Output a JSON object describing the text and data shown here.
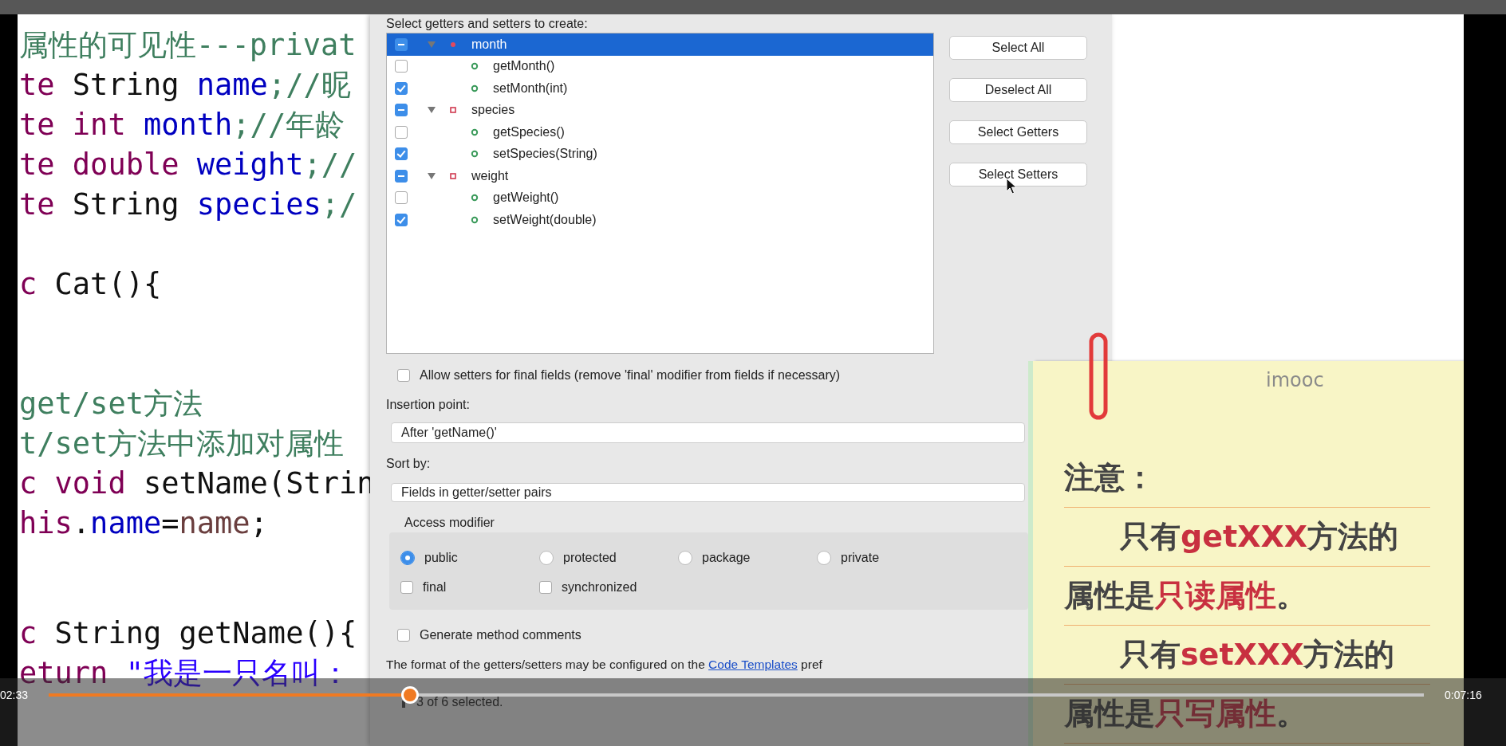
{
  "code_blocks": [
    {
      "kind": "declarations",
      "lines": [
        [
          {
            "text": "属性的可见性---privat",
            "kind": "comment"
          }
        ],
        [
          {
            "text": "te",
            "kind": "keyword"
          },
          {
            "text": " String ",
            "kind": "plain"
          },
          {
            "text": "name",
            "kind": "field"
          },
          {
            "text": ";//昵",
            "kind": "comment"
          }
        ],
        [
          {
            "text": "te int ",
            "kind": "keyword"
          },
          {
            "text": "month",
            "kind": "field"
          },
          {
            "text": ";//年龄",
            "kind": "comment"
          }
        ],
        [
          {
            "text": "te double ",
            "kind": "keyword"
          },
          {
            "text": "weight",
            "kind": "field"
          },
          {
            "text": ";//",
            "kind": "comment"
          }
        ],
        [
          {
            "text": "te",
            "kind": "keyword"
          },
          {
            "text": " String ",
            "kind": "plain"
          },
          {
            "text": "species",
            "kind": "field"
          },
          {
            "text": ";/",
            "kind": "comment"
          }
        ]
      ]
    },
    {
      "kind": "constructor",
      "lines": [
        [
          {
            "text": "c",
            "kind": "keyword"
          },
          {
            "text": " Cat(){",
            "kind": "plain"
          }
        ]
      ]
    },
    {
      "kind": "method",
      "lines": [
        [
          {
            "text": "get/set方法",
            "kind": "comment"
          }
        ],
        [
          {
            "text": "t/set方法中添加对属性",
            "kind": "comment"
          }
        ],
        [
          {
            "text": "c void",
            "kind": "keyword"
          },
          {
            "text": " setName(Strin",
            "kind": "plain"
          }
        ],
        [
          {
            "text": "his",
            "kind": "keyword"
          },
          {
            "text": ".",
            "kind": "plain"
          },
          {
            "text": "name",
            "kind": "field"
          },
          {
            "text": "=",
            "kind": "plain"
          },
          {
            "text": "name",
            "kind": "param"
          },
          {
            "text": ";",
            "kind": "plain"
          }
        ]
      ]
    },
    {
      "kind": "method",
      "lines": [
        [
          {
            "text": "c",
            "kind": "keyword"
          },
          {
            "text": " String getName(){",
            "kind": "plain"
          }
        ],
        [
          {
            "text": "eturn",
            "kind": "keyword"
          },
          {
            "text": " \"我是一只名叫：",
            "kind": "string"
          }
        ]
      ]
    }
  ],
  "dialog": {
    "heading": "Select getters and setters to create:",
    "tree": [
      {
        "label": "month",
        "kind": "field",
        "checked": true,
        "partial": true,
        "selected": true,
        "expanded": true,
        "children": [
          {
            "label": "getMonth()",
            "kind": "method",
            "checked": false,
            "selected": false
          },
          {
            "label": "setMonth(int)",
            "kind": "method",
            "checked": true,
            "selected": false
          }
        ]
      },
      {
        "label": "species",
        "kind": "field",
        "checked": true,
        "partial": true,
        "selected": false,
        "expanded": true,
        "children": [
          {
            "label": "getSpecies()",
            "kind": "method",
            "checked": false,
            "selected": false
          },
          {
            "label": "setSpecies(String)",
            "kind": "method",
            "checked": true,
            "selected": false
          }
        ]
      },
      {
        "label": "weight",
        "kind": "field",
        "checked": true,
        "partial": true,
        "selected": false,
        "expanded": true,
        "children": [
          {
            "label": "getWeight()",
            "kind": "method",
            "checked": false,
            "selected": false
          },
          {
            "label": "setWeight(double)",
            "kind": "method",
            "checked": true,
            "selected": false
          }
        ]
      }
    ],
    "buttons": [
      "Select All",
      "Deselect All",
      "Select Getters",
      "Select Setters"
    ],
    "allow_final": {
      "label": "Allow setters for final fields (remove 'final' modifier from fields if necessary)",
      "checked": false
    },
    "insertion_point": {
      "label": "Insertion point:",
      "value": "After 'getName()'"
    },
    "sort_by": {
      "label": "Sort by:",
      "value": "Fields in getter/setter pairs"
    },
    "access_modifier": {
      "label": "Access modifier",
      "options": [
        {
          "label": "public",
          "selected": true
        },
        {
          "label": "protected",
          "selected": false
        },
        {
          "label": "package",
          "selected": false
        },
        {
          "label": "private",
          "selected": false
        }
      ],
      "modifiers": [
        {
          "label": "final",
          "checked": false
        },
        {
          "label": "synchronized",
          "checked": false
        }
      ]
    },
    "comments": {
      "label": "Generate method comments",
      "checked": false
    },
    "format_note": {
      "before": "The format of the getters/setters may be configured on the ",
      "link": "Code Templates",
      "after": " pref"
    },
    "status": "3 of 6 selected."
  },
  "note": {
    "brand": "imooc",
    "lines": [
      {
        "indent": false,
        "parts": [
          {
            "text": "注意：",
            "highlight": false
          }
        ]
      },
      {
        "indent": true,
        "parts": [
          {
            "text": "只有",
            "highlight": false
          },
          {
            "text": "getXXX",
            "highlight": true
          },
          {
            "text": "方法的",
            "highlight": false
          }
        ]
      },
      {
        "indent": false,
        "parts": [
          {
            "text": "属性是",
            "highlight": false
          },
          {
            "text": "只读属性",
            "highlight": true
          },
          {
            "text": "。",
            "highlight": false
          }
        ]
      },
      {
        "indent": true,
        "parts": [
          {
            "text": "只有",
            "highlight": false
          },
          {
            "text": "setXXX",
            "highlight": true
          },
          {
            "text": "方法的",
            "highlight": false
          }
        ]
      },
      {
        "indent": false,
        "parts": [
          {
            "text": "属性是",
            "highlight": false
          },
          {
            "text": "只写属性",
            "highlight": true
          },
          {
            "text": "。",
            "highlight": false
          }
        ]
      }
    ]
  },
  "player": {
    "elapsed": "02:33",
    "duration": "0:07:16",
    "progress": {
      "level": 0.263
    }
  }
}
